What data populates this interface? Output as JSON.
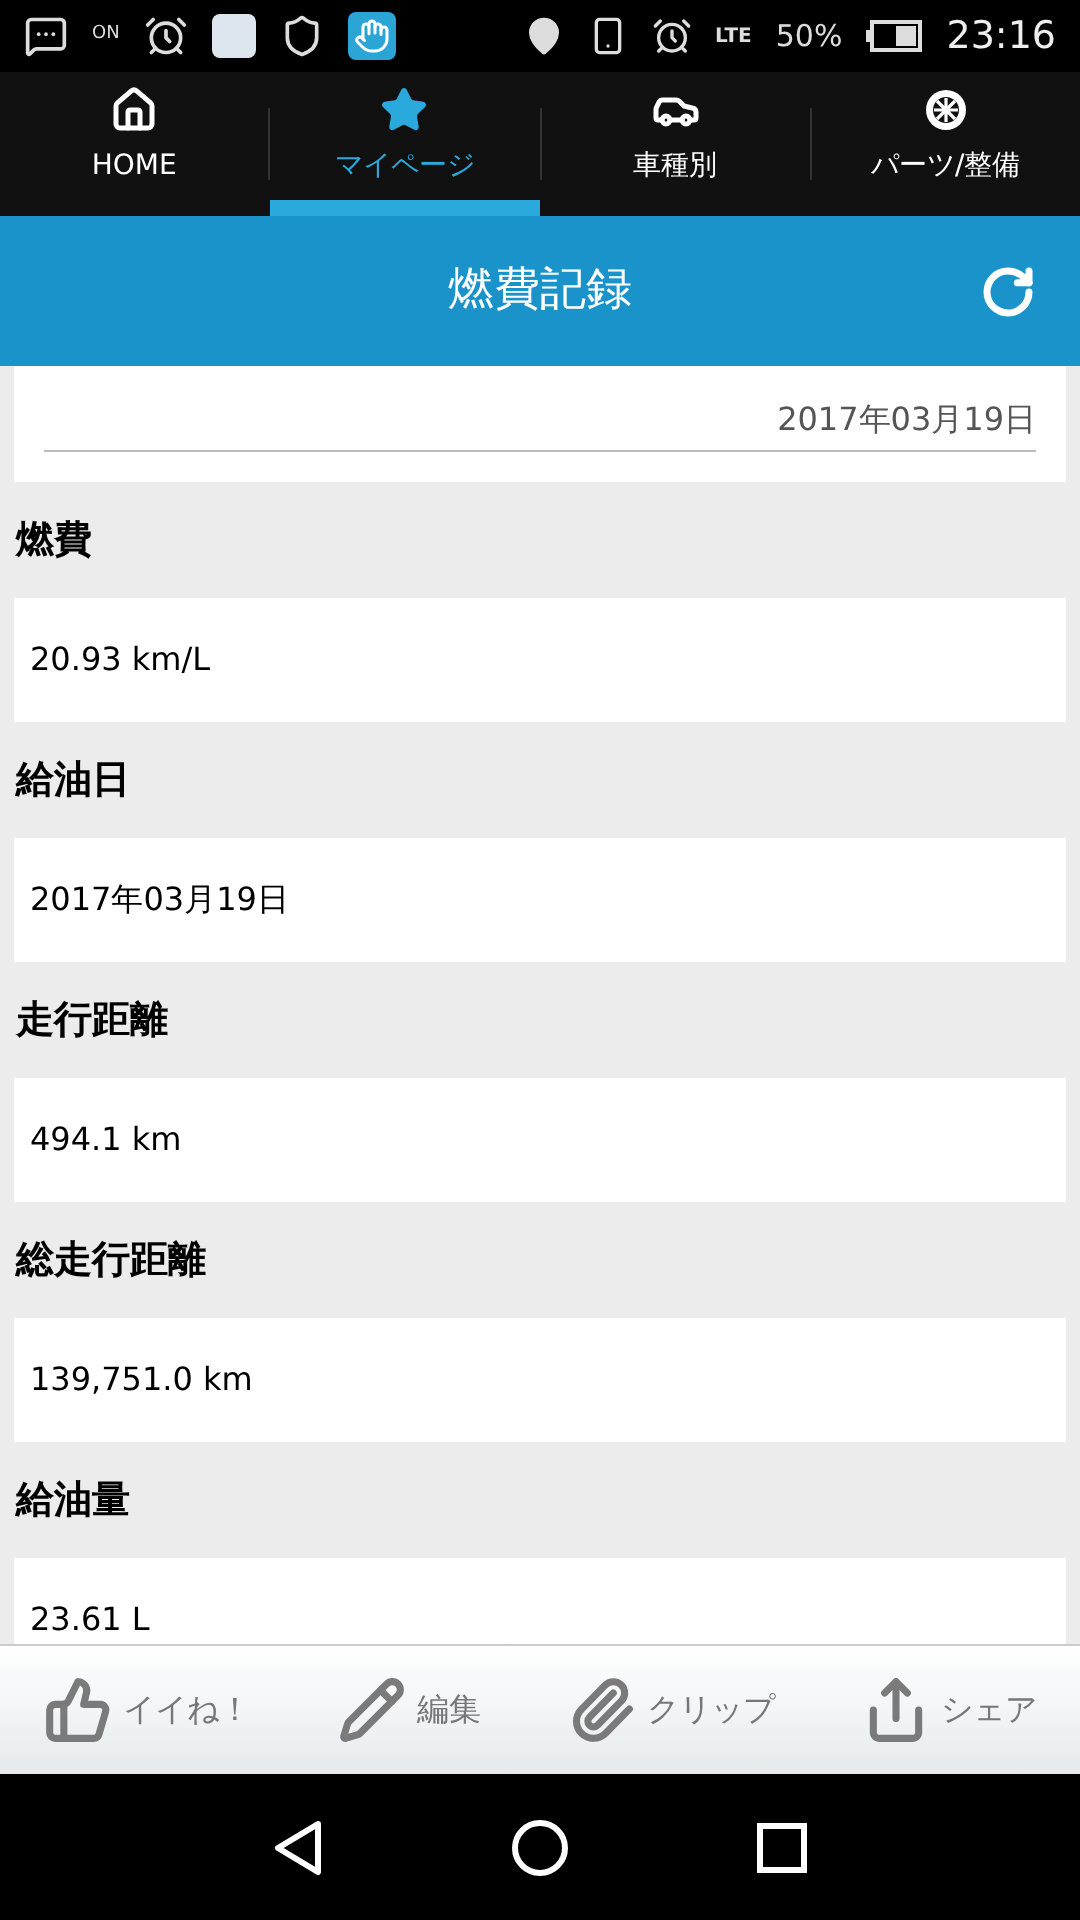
{
  "status_bar": {
    "nfc_label": "ON",
    "network_label": "LTE",
    "battery": "50%",
    "time": "23:16"
  },
  "tabs": [
    {
      "label": "HOME",
      "kind": "home",
      "selected": false
    },
    {
      "label": "マイページ",
      "kind": "star",
      "selected": true
    },
    {
      "label": "車種別",
      "kind": "car",
      "selected": false
    },
    {
      "label": "パーツ/整備",
      "kind": "wheel",
      "selected": false
    }
  ],
  "header": {
    "title": "燃費記録"
  },
  "top_card": {
    "date": "2017年03月19日"
  },
  "fields": [
    {
      "label": "燃費",
      "value": "20.93 km/L"
    },
    {
      "label": "給油日",
      "value": "2017年03月19日"
    },
    {
      "label": "走行距離",
      "value": "494.1 km"
    },
    {
      "label": "総走行距離",
      "value": "139,751.0 km"
    },
    {
      "label": "給油量",
      "value": "23.61 L"
    }
  ],
  "actions": [
    {
      "label": "イイね！",
      "kind": "like"
    },
    {
      "label": "編集",
      "kind": "edit"
    },
    {
      "label": "クリップ",
      "kind": "clip"
    },
    {
      "label": "シェア",
      "kind": "share"
    }
  ]
}
